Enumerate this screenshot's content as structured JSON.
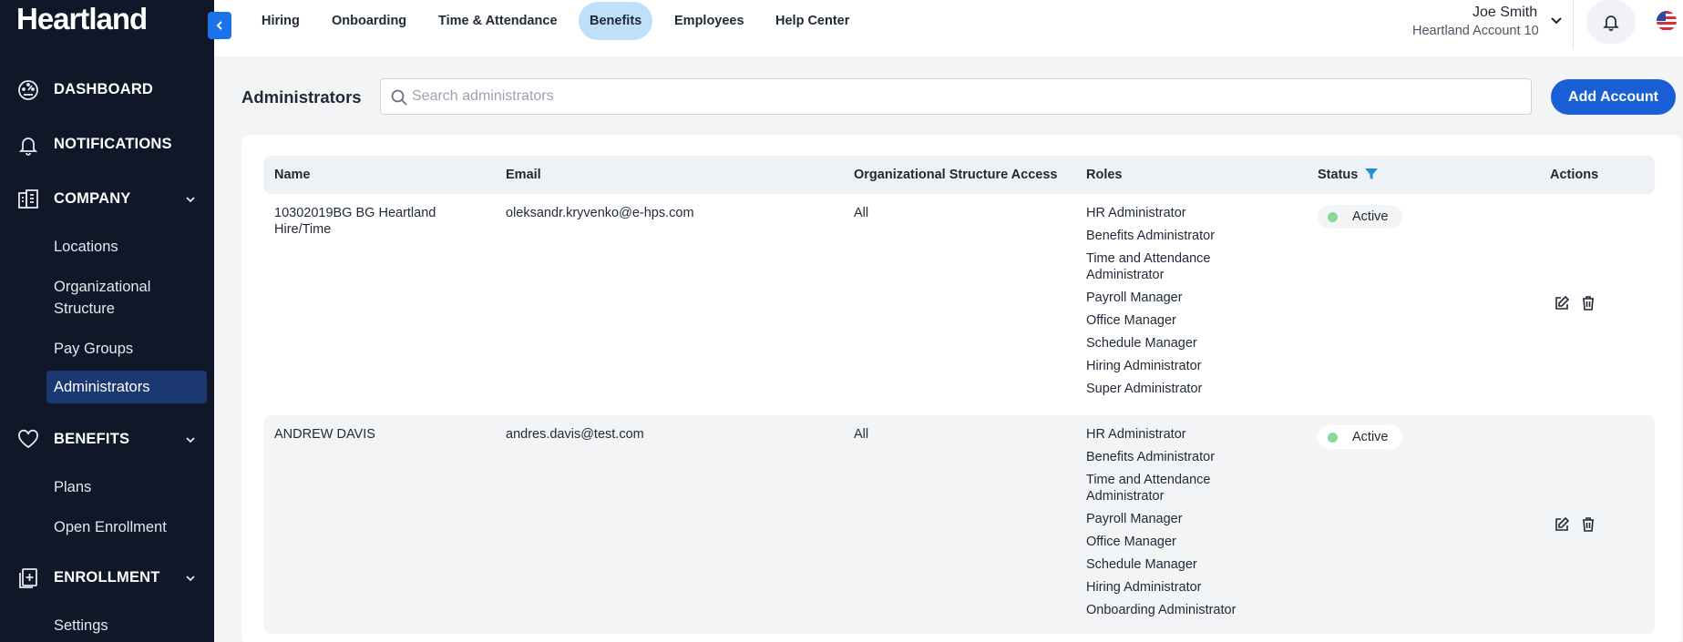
{
  "sidebar": {
    "logo": "Heartland",
    "sections": {
      "dashboard": "DASHBOARD",
      "notifications": "NOTIFICATIONS",
      "company": "COMPANY",
      "benefits": "BENEFITS",
      "enrollment": "ENROLLMENT"
    },
    "company_items": [
      "Locations",
      "Organizational Structure",
      "Pay Groups",
      "Administrators"
    ],
    "benefits_items": [
      "Plans",
      "Open Enrollment"
    ],
    "enrollment_items": [
      "Settings"
    ]
  },
  "topnav": {
    "tabs": [
      "Hiring",
      "Onboarding",
      "Time & Attendance",
      "Benefits",
      "Employees",
      "Help Center"
    ],
    "active_tab": "Benefits",
    "user_name": "Joe Smith",
    "account": "Heartland Account 10"
  },
  "page": {
    "title": "Administrators",
    "search_placeholder": "Search administrators",
    "add_button": "Add Account"
  },
  "table": {
    "headers": [
      "Name",
      "Email",
      "Organizational Structure Access",
      "Roles",
      "Status",
      "Actions"
    ],
    "rows": [
      {
        "name_line1": "10302019BG BG Heartland",
        "name_line2": "Hire/Time",
        "email": "oleksandr.kryvenko@e-hps.com",
        "access": "All",
        "roles": [
          "HR Administrator",
          "Benefits Administrator",
          "Time and Attendance",
          "Administrator",
          "Payroll Manager",
          "Office Manager",
          "Schedule Manager",
          "Hiring Administrator",
          "Super Administrator"
        ],
        "status": "Active"
      },
      {
        "name_line1": "ANDREW DAVIS",
        "email": "andres.davis@test.com",
        "access": "All",
        "roles": [
          "HR Administrator",
          "Benefits Administrator",
          "Time and Attendance",
          "Administrator",
          "Payroll Manager",
          "Office Manager",
          "Schedule Manager",
          "Hiring Administrator",
          "Onboarding Administrator"
        ],
        "status": "Active"
      }
    ]
  },
  "colors": {
    "sidebar_bg": "#0f1729",
    "active_item_bg": "#1b3870",
    "accent": "#1a5fd6",
    "active_tab_bg": "#bfe0fb",
    "status_active": "#86d99a",
    "filter_icon": "#1f8fd6"
  },
  "icons": [
    "dashboard-icon",
    "bell-icon",
    "building-icon",
    "heart-icon",
    "enrollment-icon",
    "chevron-down-icon",
    "chevron-left-icon",
    "search-icon",
    "filter-icon",
    "edit-icon",
    "trash-icon",
    "us-flag-icon"
  ]
}
